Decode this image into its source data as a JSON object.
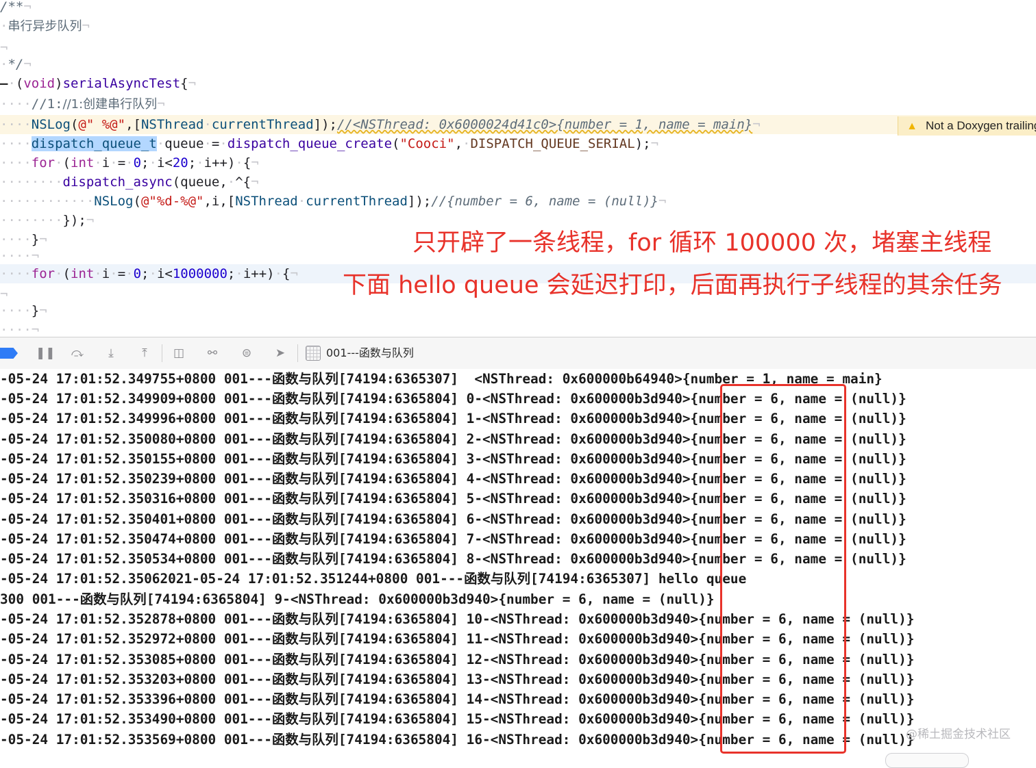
{
  "editor": {
    "comment_open": "/**",
    "comment_body": "串行异步队列",
    "comment_close": "*/",
    "method_void": "void",
    "method_name": "serialAsyncTest",
    "comment_create": "//1:创建串行队列",
    "nslog_fn": "NSLog",
    "nslog_fmt": "@\" %@\"",
    "nsthread_cls": "NSThread",
    "current_thread": "currentThread",
    "nslog_comment": "//<NSThread: 0x6000024d41c0>{number = 1, name = main}",
    "queue_type": "dispatch_queue_t",
    "queue_var": "queue",
    "queue_create_fn": "dispatch_queue_create",
    "queue_label": "\"Cooci\"",
    "queue_attr": "DISPATCH_QUEUE_SERIAL",
    "kw_for": "for",
    "kw_int": "int",
    "loop1_limit": "20",
    "async_fn": "dispatch_async",
    "inner_fmt": "@\"%d-%@\"",
    "inner_comment": "//{number = 6, name = (null)}",
    "loop2_start": "0",
    "loop2_limit": "1000000"
  },
  "warning": {
    "icon": "warning-triangle-icon",
    "text": "Not a Doxygen trailing comment"
  },
  "annotations": {
    "line1": "只开辟了一条线程，for 循环 100000 次，堵塞主线程",
    "line2": "下面 hello queue 会延迟打印，后面再执行子线程的其余任务"
  },
  "toolbar": {
    "target_label": "001---函数与队列",
    "icons": [
      "breakpoint-toggle-icon",
      "pause-icon",
      "step-over-icon",
      "step-into-icon",
      "step-out-icon",
      "view-hierarchy-icon",
      "memory-graph-icon",
      "environment-overrides-icon",
      "simulate-location-icon",
      "target-icon"
    ]
  },
  "console": {
    "lines": [
      "-05-24 17:01:52.349755+0800 001---函数与队列[74194:6365307]  <NSThread: 0x600000b64940>{number = 1, name = main}",
      "-05-24 17:01:52.349909+0800 001---函数与队列[74194:6365804] 0-<NSThread: 0x600000b3d940>{number = 6, name = (null)}",
      "-05-24 17:01:52.349996+0800 001---函数与队列[74194:6365804] 1-<NSThread: 0x600000b3d940>{number = 6, name = (null)}",
      "-05-24 17:01:52.350080+0800 001---函数与队列[74194:6365804] 2-<NSThread: 0x600000b3d940>{number = 6, name = (null)}",
      "-05-24 17:01:52.350155+0800 001---函数与队列[74194:6365804] 3-<NSThread: 0x600000b3d940>{number = 6, name = (null)}",
      "-05-24 17:01:52.350239+0800 001---函数与队列[74194:6365804] 4-<NSThread: 0x600000b3d940>{number = 6, name = (null)}",
      "-05-24 17:01:52.350316+0800 001---函数与队列[74194:6365804] 5-<NSThread: 0x600000b3d940>{number = 6, name = (null)}",
      "-05-24 17:01:52.350401+0800 001---函数与队列[74194:6365804] 6-<NSThread: 0x600000b3d940>{number = 6, name = (null)}",
      "-05-24 17:01:52.350474+0800 001---函数与队列[74194:6365804] 7-<NSThread: 0x600000b3d940>{number = 6, name = (null)}",
      "-05-24 17:01:52.350534+0800 001---函数与队列[74194:6365804] 8-<NSThread: 0x600000b3d940>{number = 6, name = (null)}",
      "-05-24 17:01:52.35062021-05-24 17:01:52.351244+0800 001---函数与队列[74194:6365307] hello queue",
      "300 001---函数与队列[74194:6365804] 9-<NSThread: 0x600000b3d940>{number = 6, name = (null)}",
      "-05-24 17:01:52.352878+0800 001---函数与队列[74194:6365804] 10-<NSThread: 0x600000b3d940>{number = 6, name = (null)}",
      "-05-24 17:01:52.352972+0800 001---函数与队列[74194:6365804] 11-<NSThread: 0x600000b3d940>{number = 6, name = (null)}",
      "-05-24 17:01:52.353085+0800 001---函数与队列[74194:6365804] 12-<NSThread: 0x600000b3d940>{number = 6, name = (null)}",
      "-05-24 17:01:52.353203+0800 001---函数与队列[74194:6365804] 13-<NSThread: 0x600000b3d940>{number = 6, name = (null)}",
      "-05-24 17:01:52.353396+0800 001---函数与队列[74194:6365804] 14-<NSThread: 0x600000b3d940>{number = 6, name = (null)}",
      "-05-24 17:01:52.353490+0800 001---函数与队列[74194:6365804] 15-<NSThread: 0x600000b3d940>{number = 6, name = (null)}",
      "-05-24 17:01:52.353569+0800 001---函数与队列[74194:6365804] 16-<NSThread: 0x600000b3d940>{number = 6, name = (null)}"
    ]
  },
  "watermark": "@稀土掘金技术社区",
  "colors": {
    "annotation_red": "#e8322a",
    "breakpoint_blue": "#2f7cf6"
  }
}
